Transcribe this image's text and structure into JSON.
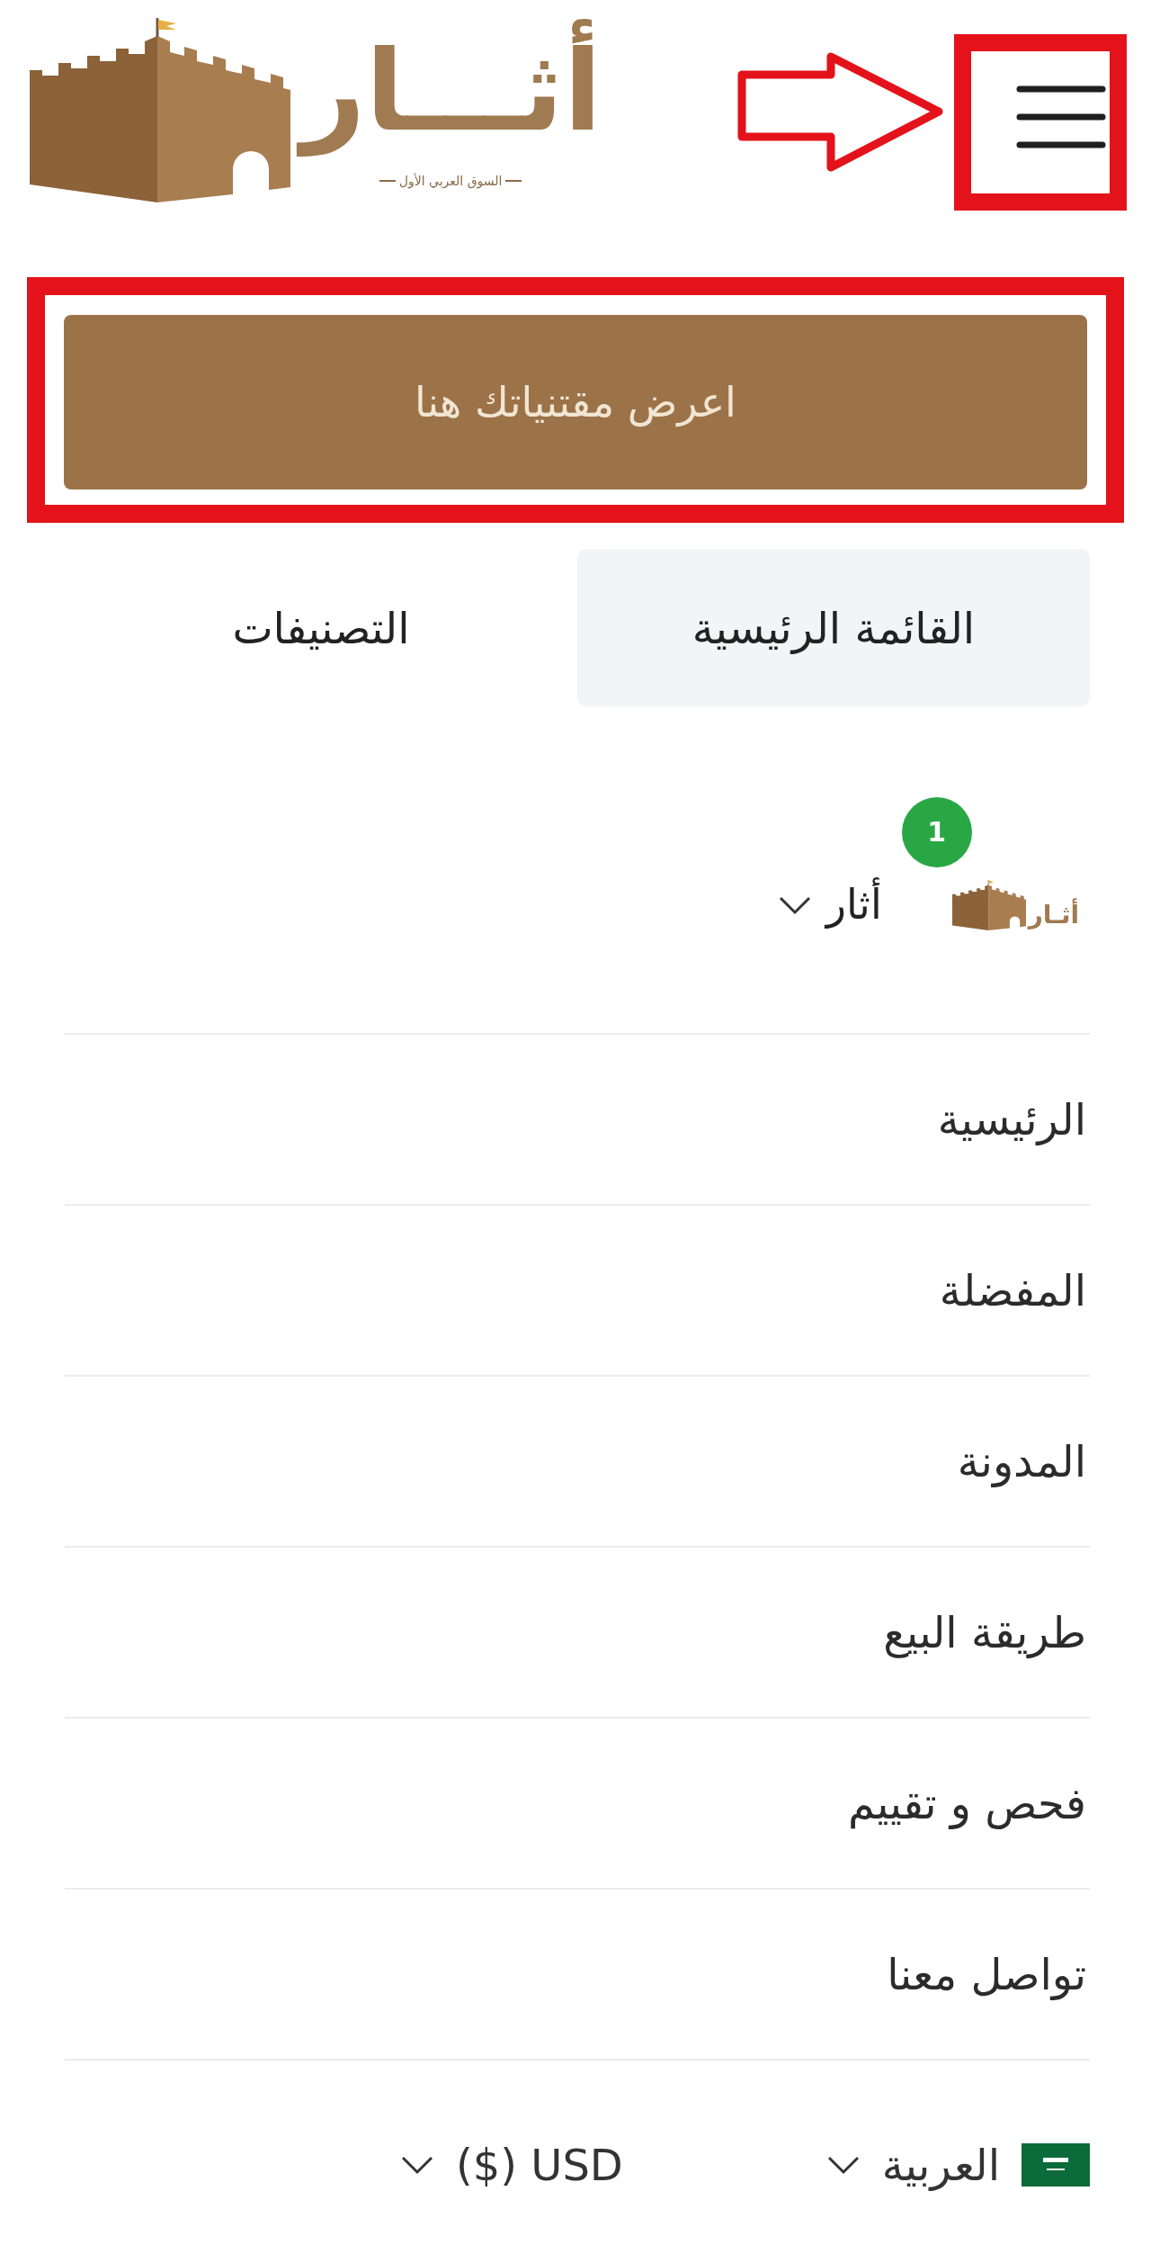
{
  "header": {
    "logo": {
      "wordmark": "أثـــار",
      "tagline": "السوق العربي الأول"
    },
    "menu_button": {
      "highlighted": true,
      "pointer_arrow": true
    }
  },
  "primary_button": {
    "label": "اعرض مقتنياتك هنا",
    "highlighted": true
  },
  "tabs": [
    {
      "label": "القائمة الرئيسية",
      "selected": true
    },
    {
      "label": "التصنيفات",
      "selected": false
    }
  ],
  "account": {
    "avatar_wordmark": "أثـار",
    "badge": "1",
    "name": "أثار"
  },
  "menu_items": [
    {
      "label": "الرئيسية"
    },
    {
      "label": "المفضلة"
    },
    {
      "label": "المدونة"
    },
    {
      "label": "طريقة البيع"
    },
    {
      "label": "فحص و تقييم"
    },
    {
      "label": "تواصل معنا"
    }
  ],
  "footer": {
    "language": {
      "label": "العربية"
    },
    "currency": {
      "label": "($) USD"
    }
  }
}
